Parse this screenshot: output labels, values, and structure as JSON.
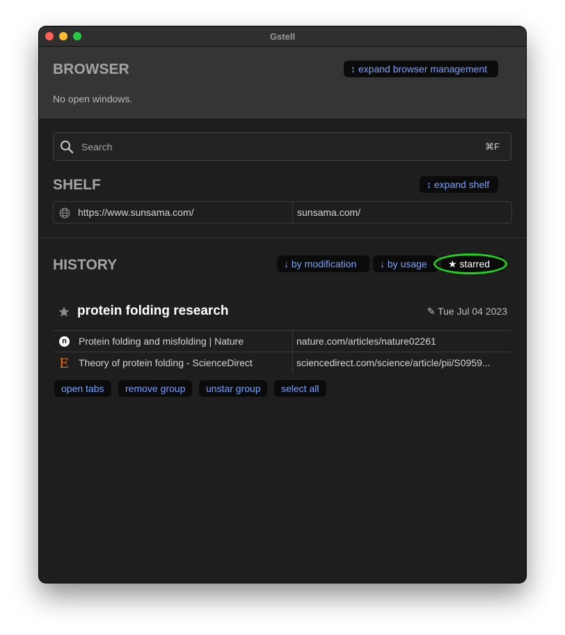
{
  "window": {
    "title": "Gstell"
  },
  "browser": {
    "title": "BROWSER",
    "expand_label": "↕ expand browser management",
    "empty_text": "No open windows."
  },
  "search": {
    "placeholder": "Search",
    "shortcut": "⌘F"
  },
  "shelf": {
    "title": "SHELF",
    "expand_label": "↕ expand shelf",
    "items": [
      {
        "icon": "globe-icon",
        "url": "https://www.sunsama.com/",
        "domain": "sunsama.com/"
      }
    ]
  },
  "history": {
    "title": "HISTORY",
    "sort_buttons": [
      {
        "label": "↓ by modification"
      },
      {
        "label": "↓ by usage"
      },
      {
        "label": "★ starred"
      }
    ],
    "group": {
      "title": "protein folding research",
      "date": "✎ Tue Jul 04 2023",
      "starred": true,
      "tabs": [
        {
          "favicon": "nature-favicon",
          "favicon_text": "n",
          "title": "Protein folding and misfolding | Nature",
          "url": "nature.com/articles/nature02261"
        },
        {
          "favicon": "elsevier-favicon",
          "favicon_text": "E",
          "title": "Theory of protein folding - ScienceDirect",
          "url": "sciencedirect.com/science/article/pii/S0959..."
        }
      ],
      "actions": [
        {
          "label": "open tabs"
        },
        {
          "label": "remove group"
        },
        {
          "label": "unstar group"
        },
        {
          "label": "select all"
        }
      ]
    }
  },
  "colors": {
    "accent_link": "#7aa2ff",
    "highlight_ring": "#21d321",
    "background": "#1e1e1e"
  }
}
